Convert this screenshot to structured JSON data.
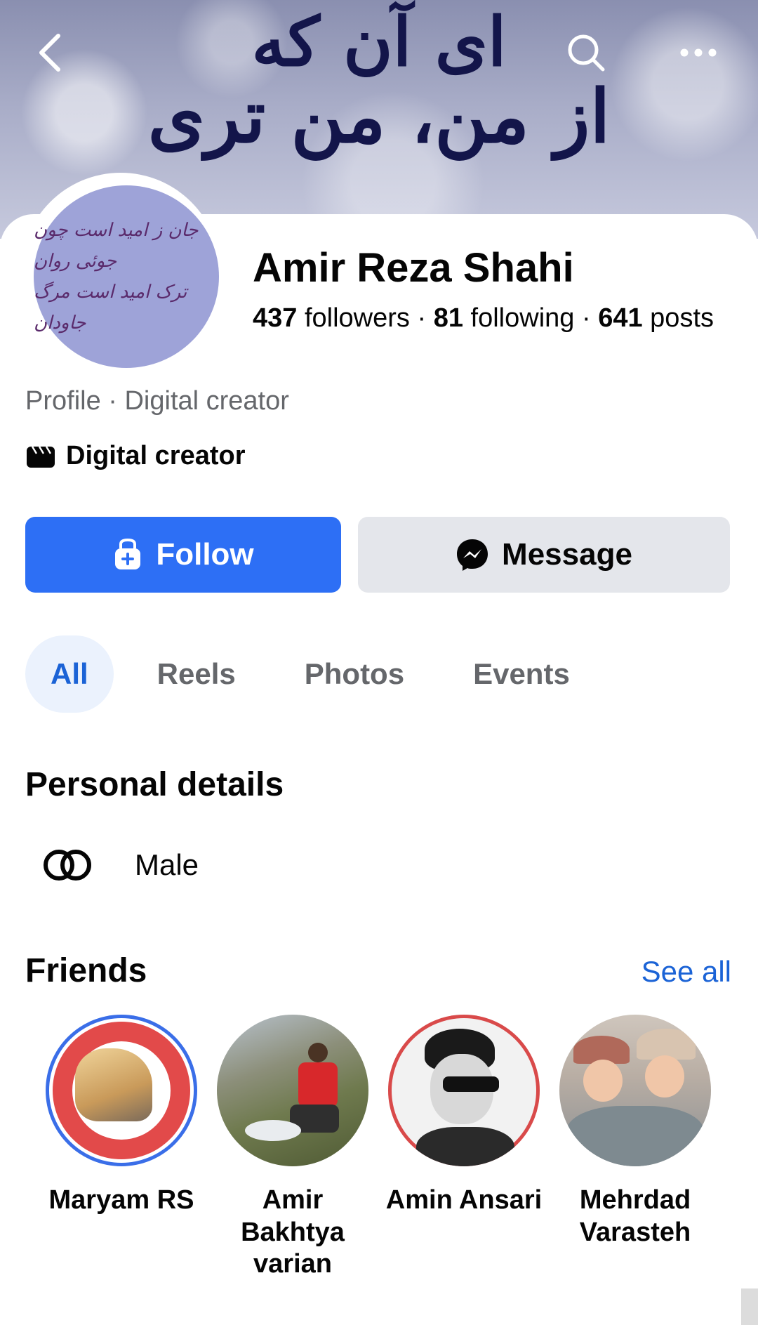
{
  "cover": {
    "line1": "ای آن که",
    "line2": "از من، من تری"
  },
  "avatar": {
    "line1": "جان ز امید است چون جوئی روان",
    "line2": "ترک امید است مرگ جاودان"
  },
  "profile": {
    "name": "Amir Reza Shahi",
    "followers_count": "437",
    "followers_label": "followers",
    "following_count": "81",
    "following_label": "following",
    "posts_count": "641",
    "posts_label": "posts",
    "separator": "·",
    "subtitle": "Profile · Digital creator",
    "category": "Digital creator"
  },
  "actions": {
    "follow": "Follow",
    "message": "Message"
  },
  "tabs": [
    "All",
    "Reels",
    "Photos",
    "Events"
  ],
  "personal_details": {
    "title": "Personal details",
    "gender": "Male"
  },
  "friends": {
    "title": "Friends",
    "see_all": "See all",
    "items": [
      {
        "name": "Maryam RS"
      },
      {
        "name": "Amir Bakhtya varian"
      },
      {
        "name": "Amin Ansari"
      },
      {
        "name": "Mehrdad Varasteh"
      }
    ]
  },
  "icons": {
    "back": "chevron-left-icon",
    "search": "search-icon",
    "more": "more-icon",
    "category": "clapperboard-icon",
    "follow": "user-plus-icon",
    "message": "messenger-icon",
    "gender": "gender-icon"
  },
  "colors": {
    "primary": "#2d6ff5",
    "link": "#1b63d6",
    "tab_active_bg": "#ebf2fd"
  }
}
